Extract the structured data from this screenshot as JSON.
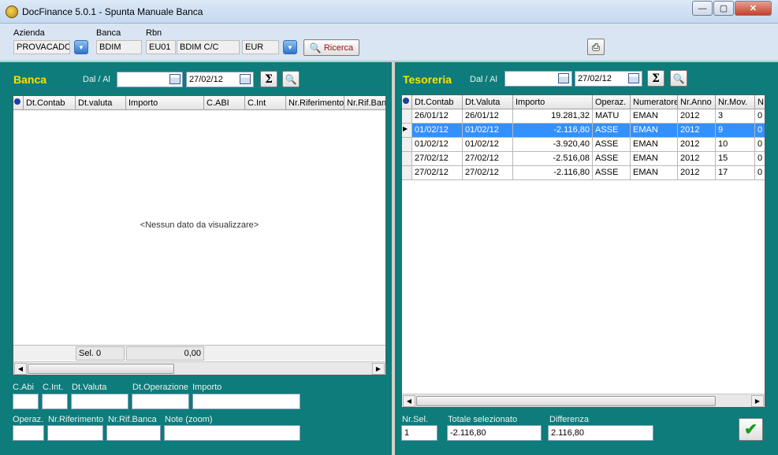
{
  "window": {
    "title": "DocFinance 5.0.1  -  Spunta Manuale Banca",
    "min": "—",
    "max": "▢",
    "close": "✕"
  },
  "top": {
    "azienda_label": "Azienda",
    "azienda_value": "PROVACADC",
    "banca_label": "Banca",
    "banca_value": "BDIM",
    "rbn_label": "Rbn",
    "rbn_code": "EU01",
    "rbn_desc": "BDIM C/C",
    "currency": "EUR",
    "search_label": "Ricerca"
  },
  "banca": {
    "title": "Banca",
    "range_label": "Dal / Al",
    "date_from": "",
    "date_to": "27/02/12",
    "columns": [
      "Dt.Contab",
      "Dt.valuta",
      "Importo",
      "C.ABI",
      "C.Int",
      "Nr.Riferimento",
      "Nr.Rif.Ban"
    ],
    "empty_text": "<Nessun dato da visualizzare>",
    "footer_sel": "Sel. 0",
    "footer_total": "0,00",
    "form": {
      "cabi_label": "C.Abi",
      "cint_label": "C.Int.",
      "dtvaluta_label": "Dt.Valuta",
      "dtop_label": "Dt.Operazione",
      "importo_label": "Importo",
      "operaz_label": "Operaz.",
      "nrrif_label": "Nr.Riferimento",
      "nrrifbanca_label": "Nr.Rif.Banca",
      "note_label": "Note (zoom)"
    }
  },
  "tesoreria": {
    "title": "Tesoreria",
    "range_label": "Dal / Al",
    "date_from": "",
    "date_to": "27/02/12",
    "columns": [
      "Dt.Contab",
      "Dt.Valuta",
      "Importo",
      "Operaz.",
      "Numeratore",
      "Nr.Anno",
      "Nr.Mov.",
      "N"
    ],
    "rows": [
      [
        "26/01/12",
        "26/01/12",
        "19.281,32",
        "MATU",
        "EMAN",
        "2012",
        "3",
        "0"
      ],
      [
        "01/02/12",
        "01/02/12",
        "-2.116,80",
        "ASSE",
        "EMAN",
        "2012",
        "9",
        "0"
      ],
      [
        "01/02/12",
        "01/02/12",
        "-3.920,40",
        "ASSE",
        "EMAN",
        "2012",
        "10",
        "0"
      ],
      [
        "27/02/12",
        "27/02/12",
        "-2.516,08",
        "ASSE",
        "EMAN",
        "2012",
        "15",
        "0"
      ],
      [
        "27/02/12",
        "27/02/12",
        "-2.116,80",
        "ASSE",
        "EMAN",
        "2012",
        "17",
        "0"
      ]
    ],
    "selected_row": 1,
    "nrsel_label": "Nr.Sel.",
    "nrsel_value": "1",
    "totale_label": "Totale selezionato",
    "totale_value": "-2.116,80",
    "diff_label": "Differenza",
    "diff_value": "2.116,80"
  },
  "colors": {
    "panel": "#0e7c7b",
    "panel_title": "#ffe000",
    "selection": "#3390ff"
  }
}
